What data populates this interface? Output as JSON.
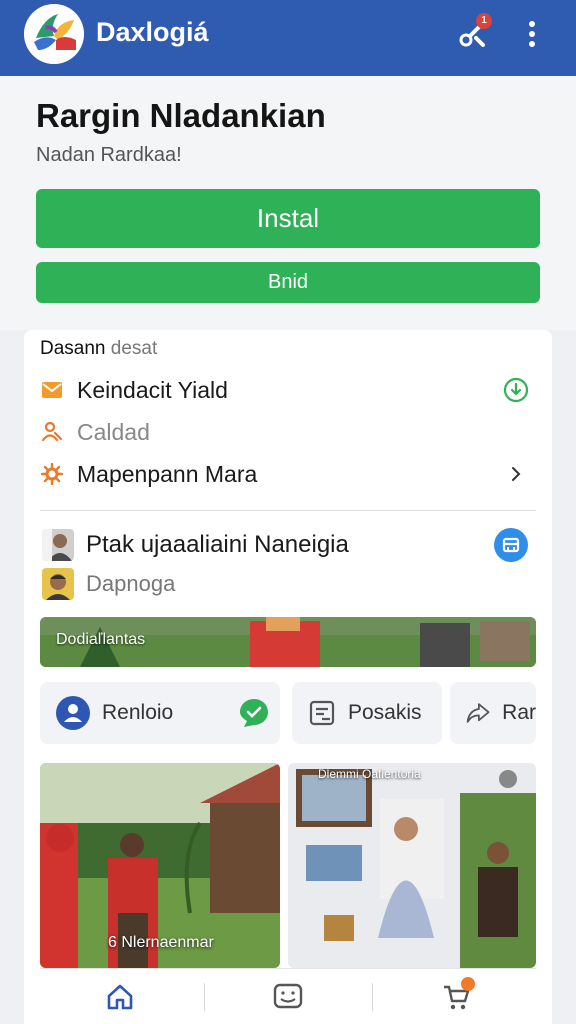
{
  "app": {
    "title": "Daxlogiá",
    "notification_count": "1",
    "colors": {
      "brand_bar": "#2f5bb0",
      "primary_button": "#2eb157",
      "badge": "#e0403a",
      "info_badge": "#2f8fe8"
    }
  },
  "product": {
    "title": "Rargin Nladankian",
    "subtitle": "Nadan Rardkaa!",
    "install_label": "Instal",
    "second_label": "Bnid"
  },
  "details": {
    "label_bold": "Dasann",
    "label_muted": "desat",
    "rows": [
      {
        "label": "Keindacit Yiald",
        "icon": "mail-icon"
      },
      {
        "label": "Caldad",
        "icon": "person-icon"
      },
      {
        "label": "Mapenpann Mara",
        "icon": "gear-icon"
      }
    ]
  },
  "people": [
    {
      "label": "Ptak ujaaaliaini Naneigia",
      "avatar": "avatar-man"
    },
    {
      "label": "Dapnoga",
      "avatar": "avatar-woman"
    }
  ],
  "banner": {
    "label": "Dodiaľlantas"
  },
  "actions": [
    {
      "label": "Renloio",
      "icon": "user-icon"
    },
    {
      "label": "Posakis",
      "icon": "document-icon"
    },
    {
      "label": "Rar",
      "icon": "share-icon"
    }
  ],
  "gallery": {
    "caption_1": "6 Nlernaenmar",
    "caption_2": "Dlemmi Oafientoria"
  },
  "bottom_nav": {
    "items": [
      {
        "name": "home",
        "icon": "home-icon"
      },
      {
        "name": "messages",
        "icon": "chat-icon"
      },
      {
        "name": "cart",
        "icon": "cart-icon"
      }
    ]
  }
}
